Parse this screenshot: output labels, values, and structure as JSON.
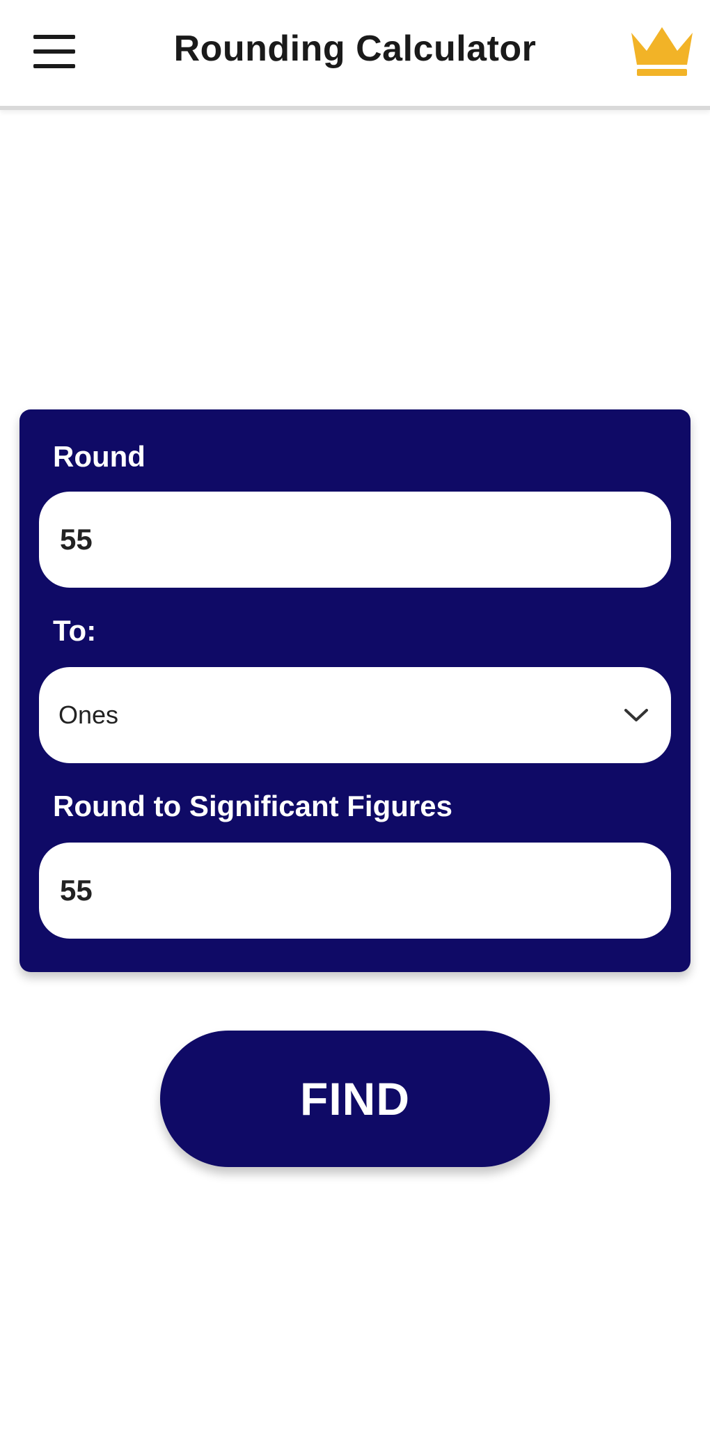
{
  "appbar": {
    "title": "Rounding Calculator",
    "menu_icon": "hamburger-menu-icon",
    "premium_icon": "crown-icon",
    "crown_color": "#f2b327"
  },
  "form": {
    "round_label": "Round",
    "round_value": "55",
    "to_label": "To:",
    "to_selected": "Ones",
    "sigfig_label": "Round to Significant Figures",
    "sigfig_value": "55"
  },
  "actions": {
    "find_label": "FIND"
  },
  "colors": {
    "primary": "#0f0a66",
    "background": "#ffffff"
  }
}
